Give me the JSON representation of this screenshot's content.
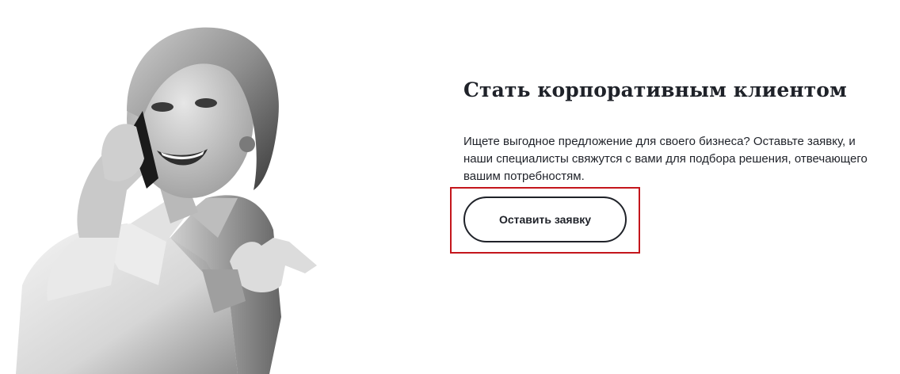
{
  "hero": {
    "image": "woman-on-phone-photo"
  },
  "section": {
    "title": "Стать корпоративным клиентом",
    "description": "Ищете выгодное предложение для своего бизнеса? Оставьте заявку, и наши специалисты свяжутся с вами для подбора решения, отвечающего вашим потребностям."
  },
  "cta": {
    "label": "Оставить заявку"
  },
  "colors": {
    "text": "#1f2229",
    "highlight": "#c4161c",
    "background": "#ffffff"
  }
}
